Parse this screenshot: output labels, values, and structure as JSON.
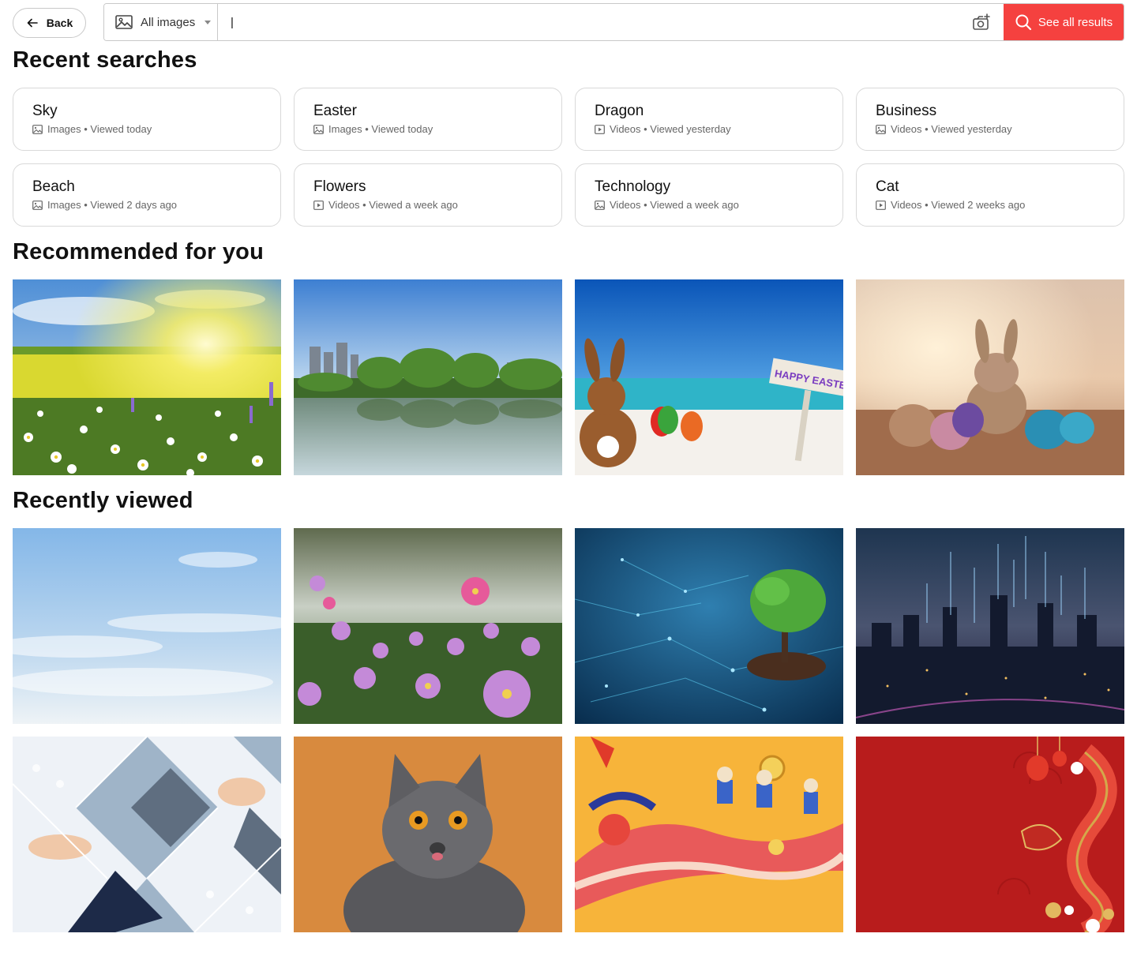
{
  "header": {
    "back_label": "Back",
    "filter_label": "All images",
    "search_value": "|",
    "see_all_label": "See all results",
    "accent_color": "#f5413f"
  },
  "sections": {
    "recent_searches": "Recent searches",
    "recommended": "Recommended for you",
    "recently_viewed": "Recently viewed"
  },
  "recent_searches": [
    {
      "title": "Sky",
      "meta": "Images • Viewed today",
      "icon": "image-icon"
    },
    {
      "title": "Easter",
      "meta": "Images • Viewed today",
      "icon": "image-icon"
    },
    {
      "title": "Dragon",
      "meta": "Videos • Viewed yesterday",
      "icon": "video-icon"
    },
    {
      "title": "Business",
      "meta": "Videos • Viewed yesterday",
      "icon": "image-icon"
    },
    {
      "title": "Beach",
      "meta": "Images • Viewed 2 days ago",
      "icon": "image-icon"
    },
    {
      "title": "Flowers",
      "meta": "Videos • Viewed a week ago",
      "icon": "video-icon"
    },
    {
      "title": "Technology",
      "meta": "Videos • Viewed a week ago",
      "icon": "image-icon"
    },
    {
      "title": "Cat",
      "meta": "Videos • Viewed 2 weeks ago",
      "icon": "video-icon"
    }
  ],
  "recommended": {
    "easter_sign": "HAPPY EASTE"
  }
}
